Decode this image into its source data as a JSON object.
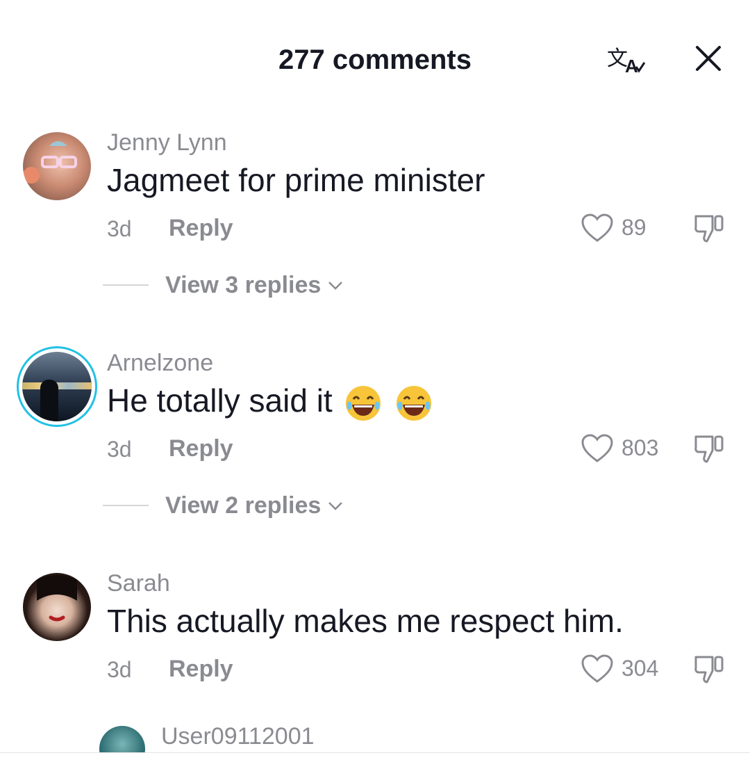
{
  "header": {
    "title": "277 comments",
    "translate_icon": "translate-icon",
    "close_icon": "close-icon"
  },
  "comments": [
    {
      "username": "Jenny Lynn",
      "text": "Jagmeet for prime minister",
      "time": "3d",
      "reply_label": "Reply",
      "likes": "89",
      "view_replies": "View 3 replies"
    },
    {
      "username": "Arnelzone",
      "text": "He totally said it ",
      "time": "3d",
      "reply_label": "Reply",
      "likes": "803",
      "view_replies": "View 2 replies"
    },
    {
      "username": "Sarah",
      "text": "This actually makes me respect him.",
      "time": "3d",
      "reply_label": "Reply",
      "likes": "304"
    },
    {
      "username": "User09112001"
    }
  ]
}
